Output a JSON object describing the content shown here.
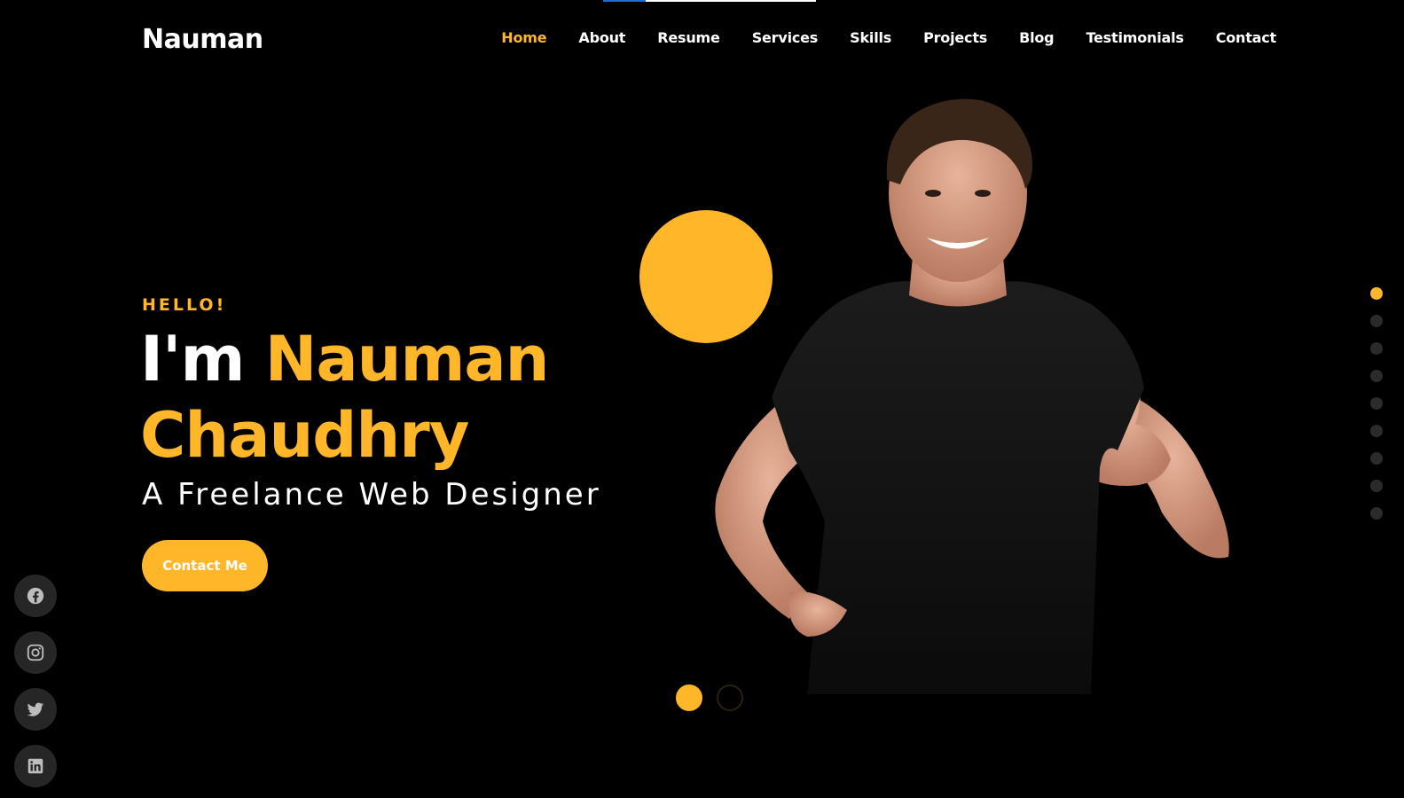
{
  "header": {
    "brand": "Nauman",
    "nav": [
      {
        "label": "Home",
        "active": true
      },
      {
        "label": "About"
      },
      {
        "label": "Resume"
      },
      {
        "label": "Services"
      },
      {
        "label": "Skills"
      },
      {
        "label": "Projects"
      },
      {
        "label": "Blog"
      },
      {
        "label": "Testimonials"
      },
      {
        "label": "Contact"
      }
    ]
  },
  "hero": {
    "greeting": "HELLO!",
    "intro": "I'm",
    "first_name": "Nauman",
    "last_name": "Chaudhry",
    "role": "A Freelance Web Designer",
    "cta_label": "Contact Me"
  },
  "slider": {
    "count": 2,
    "active_index": 0
  },
  "section_dots": {
    "count": 9,
    "active_index": 0
  },
  "social": [
    "facebook-icon",
    "instagram-icon",
    "twitter-icon",
    "linkedin-icon"
  ],
  "colors": {
    "accent": "#ffb628",
    "background": "#000000",
    "progress": "#1f6fd1"
  },
  "scroll_progress_fraction": 0.2
}
